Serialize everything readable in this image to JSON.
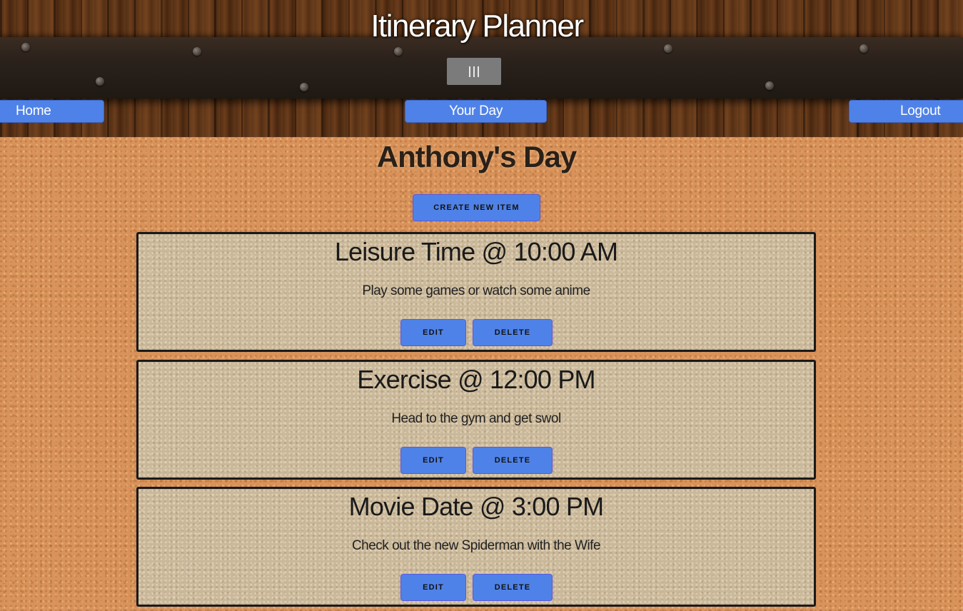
{
  "header": {
    "site_title": "Itinerary Planner",
    "menu_icon": "hamburger-vertical-bars-icon"
  },
  "nav": {
    "home": "Home",
    "your_day": "Your Day",
    "logout": "Logout"
  },
  "main": {
    "heading": "Anthony's Day",
    "create_label": "CREATE NEW ITEM"
  },
  "items": [
    {
      "title": "Leisure Time @ 10:00 AM",
      "description": "Play some games or watch some anime",
      "edit_label": "EDIT",
      "delete_label": "DELETE"
    },
    {
      "title": "Exercise @ 12:00 PM",
      "description": "Head to the gym and get swol",
      "edit_label": "EDIT",
      "delete_label": "DELETE"
    },
    {
      "title": "Movie Date @ 3:00 PM",
      "description": "Check out the new Spiderman with the Wife",
      "edit_label": "EDIT",
      "delete_label": "DELETE"
    }
  ],
  "colors": {
    "button_blue": "#4f82e8",
    "cork": "#d9935a",
    "card_border": "#1a1a1a"
  }
}
